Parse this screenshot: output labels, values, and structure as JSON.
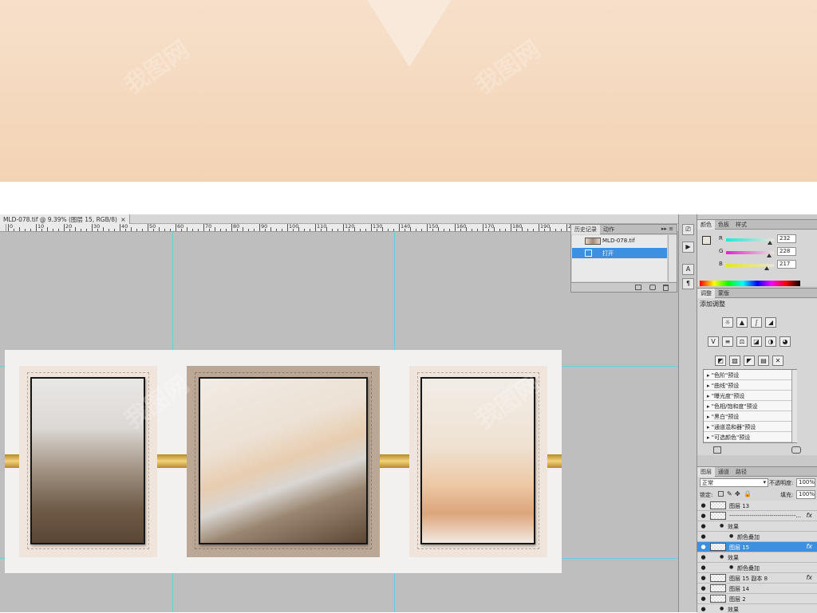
{
  "document_tab": {
    "title": "MLD-078.tif @ 9.39% (图层 15, RGB/8)",
    "close": "×"
  },
  "ruler_labels": [
    "0",
    "10",
    "20",
    "30",
    "40",
    "50",
    "60",
    "70",
    "80",
    "90",
    "100",
    "110",
    "120",
    "130",
    "140",
    "150",
    "160",
    "170",
    "180",
    "190",
    "200"
  ],
  "history_panel": {
    "tabs": [
      "历史记录",
      "动作"
    ],
    "snapshot": "MLD-078.tif",
    "step": "打开",
    "menu_glyph": "▸▸ ≡"
  },
  "color_panel": {
    "tabs": [
      "颜色",
      "色板",
      "样式"
    ],
    "channels": [
      {
        "label": "R",
        "value": "232",
        "fill": 0.91
      },
      {
        "label": "G",
        "value": "228",
        "fill": 0.894
      },
      {
        "label": "B",
        "value": "217",
        "fill": 0.851
      }
    ],
    "swatch": "#e8e4d9"
  },
  "adjustments_panel": {
    "tabs": [
      "调整",
      "蒙版"
    ],
    "title": "添加调整",
    "presets": [
      "\"色阶\"预设",
      "\"曲线\"预设",
      "\"曝光度\"预设",
      "\"色相/饱和度\"预设",
      "\"黑白\"预设",
      "\"通道混和器\"预设",
      "\"可选颜色\"预设"
    ]
  },
  "layers_panel": {
    "tabs": [
      "图层",
      "通道",
      "路径"
    ],
    "blend_mode": "正常",
    "opacity_label": "不透明度:",
    "opacity_value": "100%",
    "lock_label": "锁定:",
    "fill_label": "填充:",
    "fill_value": "100%",
    "layers": [
      {
        "name": "图层 13",
        "fx": "",
        "sel": false,
        "indent": 0,
        "thumb": true
      },
      {
        "name": "---------------------------------...",
        "fx": "fx",
        "sel": false,
        "indent": 0,
        "thumb": true
      },
      {
        "name": "效果",
        "fx": "",
        "sel": false,
        "indent": 1,
        "thumb": false
      },
      {
        "name": "颜色叠加",
        "fx": "",
        "sel": false,
        "indent": 2,
        "thumb": false
      },
      {
        "name": "图层 15",
        "fx": "fx",
        "sel": true,
        "indent": 0,
        "thumb": true
      },
      {
        "name": "效果",
        "fx": "",
        "sel": false,
        "indent": 1,
        "thumb": false
      },
      {
        "name": "颜色叠加",
        "fx": "",
        "sel": false,
        "indent": 2,
        "thumb": false
      },
      {
        "name": "图层 15 副本 8",
        "fx": "fx",
        "sel": false,
        "indent": 0,
        "thumb": true
      },
      {
        "name": "图层 14",
        "fx": "",
        "sel": false,
        "indent": 0,
        "thumb": true
      },
      {
        "name": "图层 2",
        "fx": "",
        "sel": false,
        "indent": 0,
        "thumb": true
      },
      {
        "name": "效果",
        "fx": "",
        "sel": false,
        "indent": 1,
        "thumb": false
      }
    ]
  },
  "watermark_text": "我图网",
  "colors": {
    "accent": "#3d8fe0",
    "guide": "#49d4e0",
    "gold": "#d9b24f"
  }
}
